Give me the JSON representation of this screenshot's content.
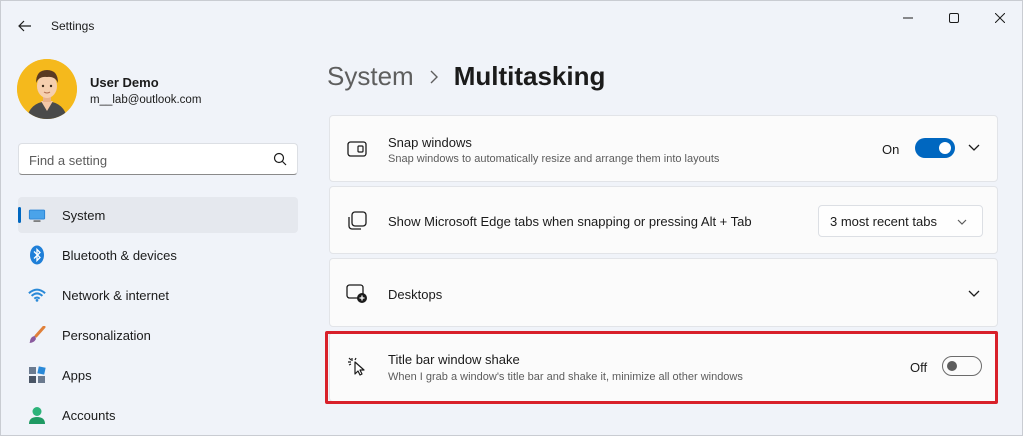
{
  "window": {
    "title": "Settings"
  },
  "user": {
    "name": "User Demo",
    "email": "m__lab@outlook.com"
  },
  "search": {
    "placeholder": "Find a setting"
  },
  "sidebar": {
    "items": [
      {
        "label": "System",
        "icon": "system-icon",
        "active": true
      },
      {
        "label": "Bluetooth & devices",
        "icon": "bluetooth-icon"
      },
      {
        "label": "Network & internet",
        "icon": "wifi-icon"
      },
      {
        "label": "Personalization",
        "icon": "brush-icon"
      },
      {
        "label": "Apps",
        "icon": "apps-icon"
      },
      {
        "label": "Accounts",
        "icon": "accounts-icon"
      }
    ]
  },
  "breadcrumb": {
    "parent": "System",
    "current": "Multitasking"
  },
  "settings": {
    "snap": {
      "title": "Snap windows",
      "description": "Snap windows to automatically resize and arrange them into layouts",
      "state": "On",
      "icon": "snap-windows-icon"
    },
    "edge_tabs": {
      "title": "Show Microsoft Edge tabs when snapping or pressing Alt + Tab",
      "value": "3 most recent tabs",
      "icon": "edge-tabs-icon"
    },
    "desktops": {
      "title": "Desktops",
      "icon": "desktops-icon"
    },
    "shake": {
      "title": "Title bar window shake",
      "description": "When I grab a window's title bar and shake it, minimize all other windows",
      "state": "Off",
      "icon": "window-shake-icon"
    }
  },
  "colors": {
    "accent": "#0067c0",
    "highlight": "#d8202a",
    "avatar_bg": "#f5b91c"
  }
}
